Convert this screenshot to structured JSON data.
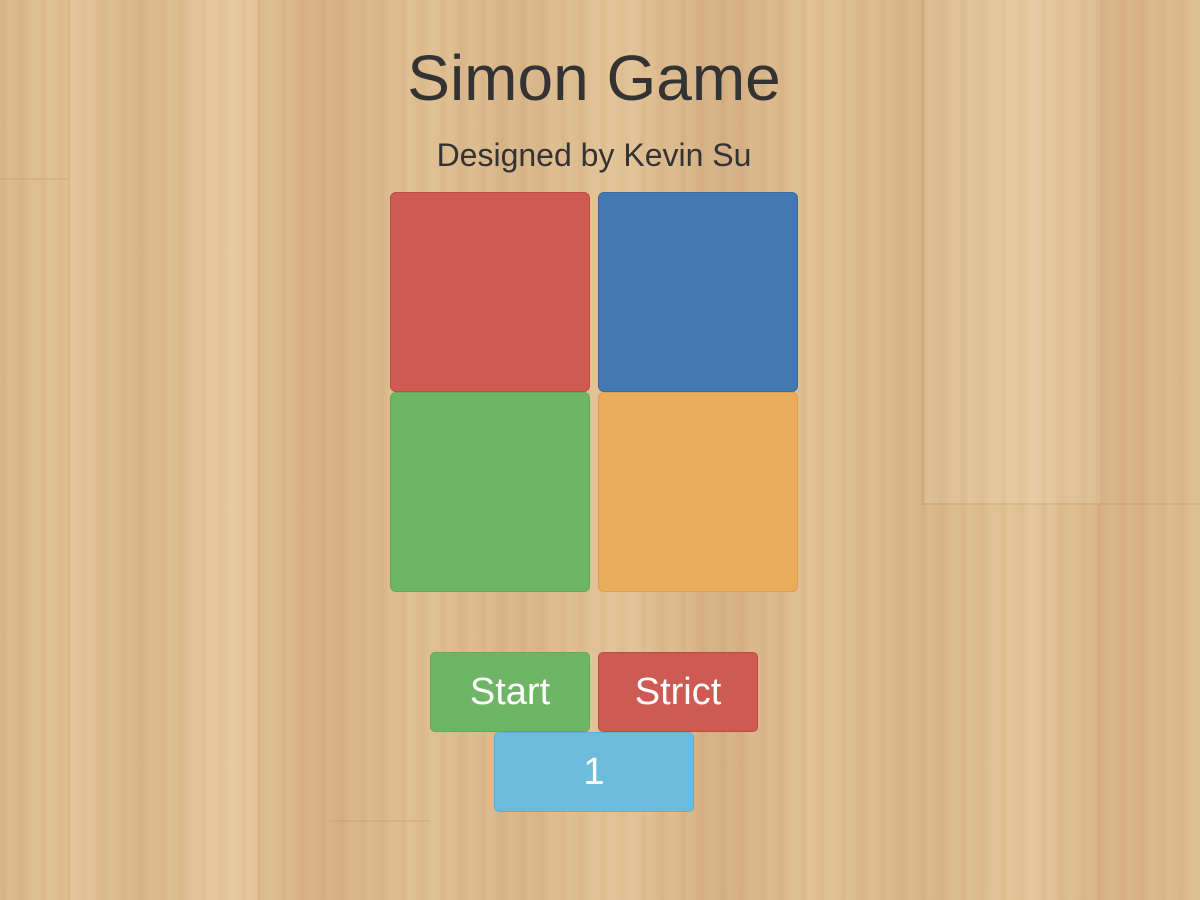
{
  "header": {
    "title": "Simon Game",
    "subtitle": "Designed by Kevin Su"
  },
  "board": {
    "pads": [
      {
        "color_name": "red",
        "color": "#cd5a53"
      },
      {
        "color_name": "blue",
        "color": "#4378b0"
      },
      {
        "color_name": "green",
        "color": "#6fb566"
      },
      {
        "color_name": "yellow",
        "color": "#e8ac5b"
      }
    ]
  },
  "controls": {
    "start_label": "Start",
    "strict_label": "Strict",
    "count": "1"
  },
  "colors": {
    "text": "#333333",
    "background": "#dcb98e",
    "counter": "#6ebcdc"
  }
}
